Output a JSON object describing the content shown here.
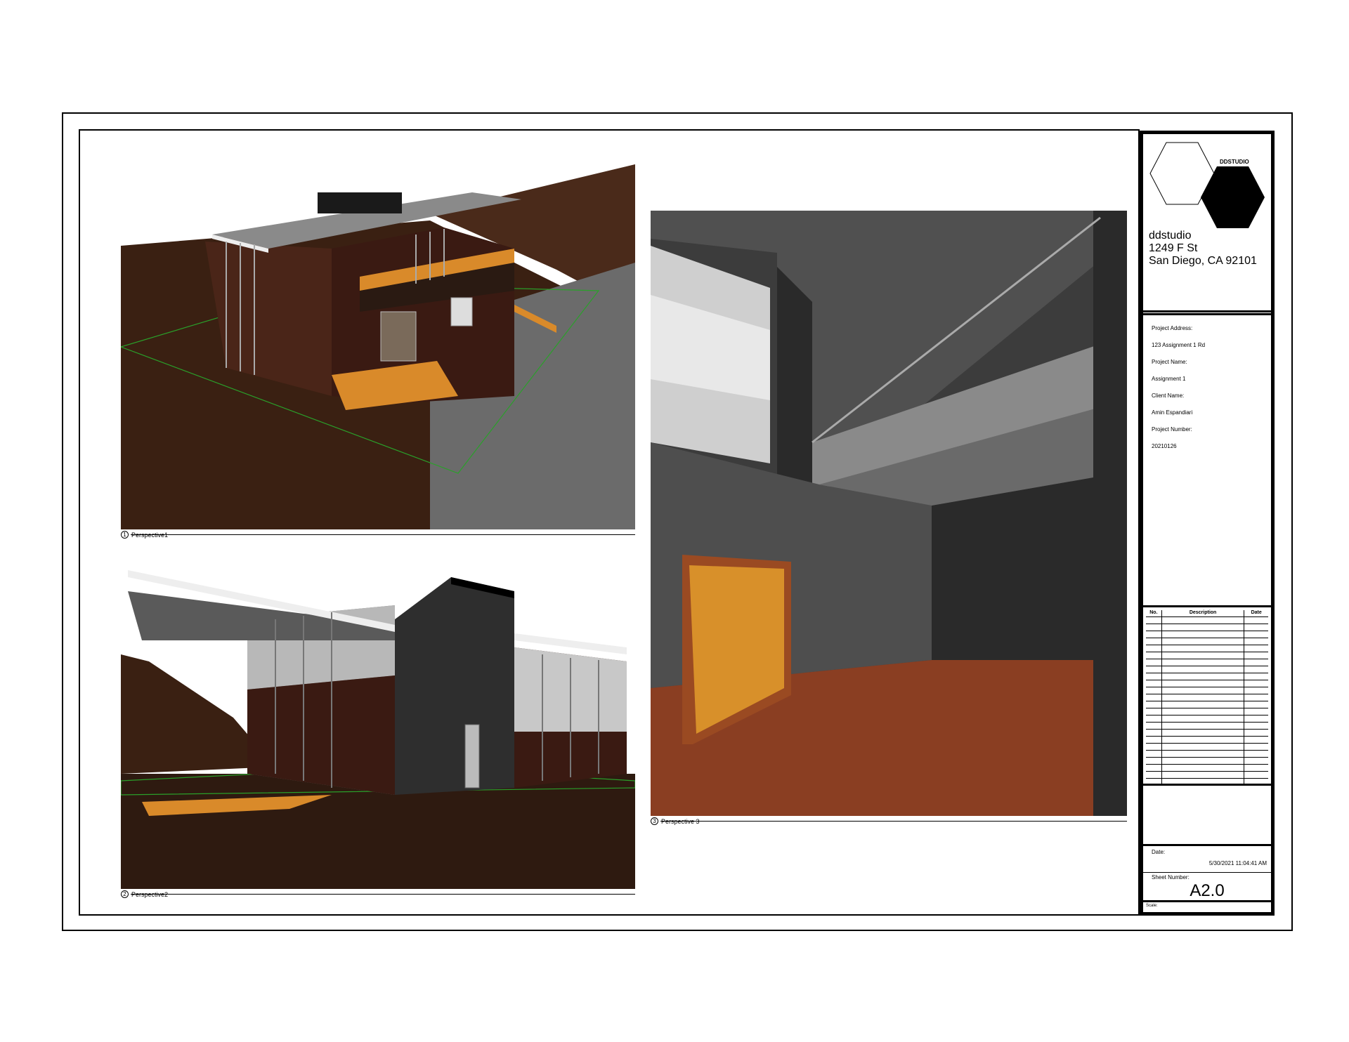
{
  "views": [
    {
      "number": "1",
      "label": "Perspective1"
    },
    {
      "number": "2",
      "label": "Perspective2"
    },
    {
      "number": "3",
      "label": "Perspective 3"
    }
  ],
  "title_block": {
    "logo_word": "DDSTUDIO",
    "firm_name": "ddstudio",
    "firm_address_1": "1249 F St",
    "firm_address_2": "San Diego, CA 92101",
    "project_address_label": "Project Address:",
    "project_address": "123 Assignment 1 Rd",
    "project_name_label": "Project Name:",
    "project_name": "Assignment 1",
    "client_name_label": "Client Name:",
    "client_name": "Amin Espandiari",
    "project_number_label": "Project Number:",
    "project_number": "20210126",
    "revisions": {
      "col_no": "No.",
      "col_description": "Description",
      "col_date": "Date"
    },
    "date_label": "Date:",
    "date_value": "5/30/2021 11:04:41 AM",
    "sheet_number_label": "Sheet Number:",
    "sheet_number": "A2.0",
    "scale_label": "Scale:"
  },
  "colors": {
    "ground": "#3a2012",
    "wall_dark": "#3a1a12",
    "wood": "#d98a2a",
    "interior_gray": "#4a4a4a",
    "floor": "#8a3e22"
  }
}
